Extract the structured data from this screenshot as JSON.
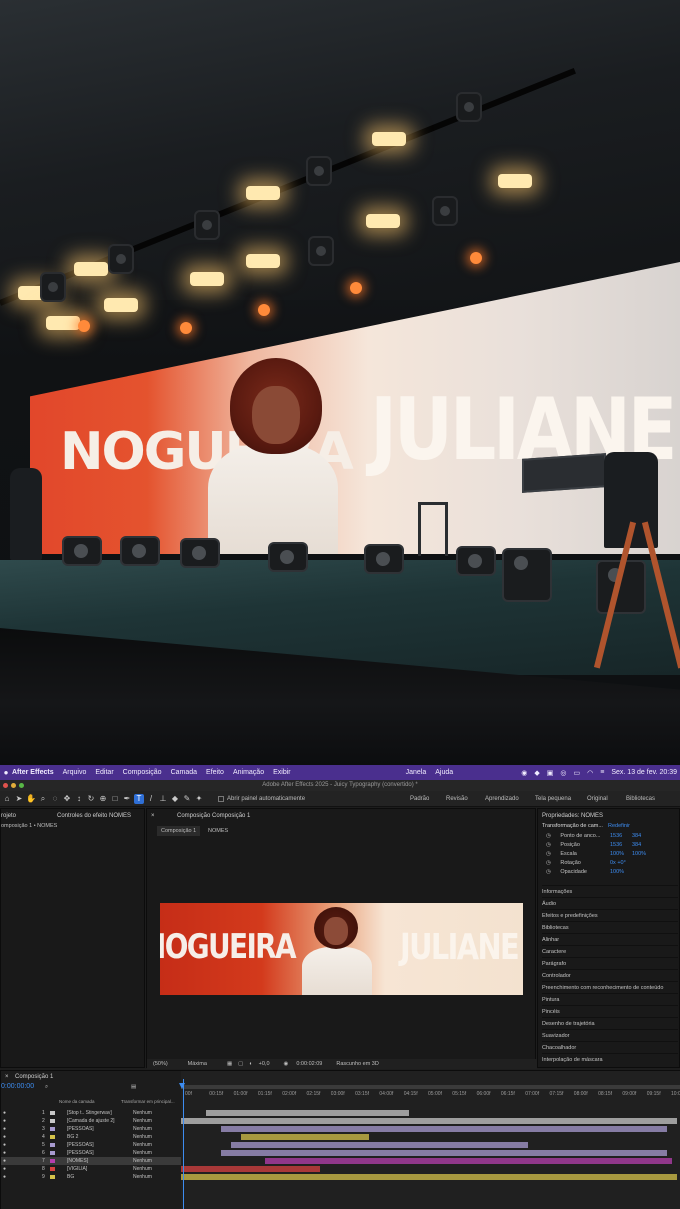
{
  "menubar": {
    "app_name": "After Effects",
    "items": [
      "Arquivo",
      "Editar",
      "Composição",
      "Camada",
      "Efeito",
      "Animação",
      "Exibir",
      "Janela",
      "Ajuda"
    ],
    "date_time": "Sex. 13 de fev. 20:39"
  },
  "window_title": "Adobe After Effects 2025 - Juicy Typography (convertido) *",
  "toolbar": {
    "auto_panel": "Abrir painel automaticamente",
    "workspaces": [
      "Padrão",
      "Revisão",
      "Aprendizado",
      "Tela pequena",
      "Original",
      "Bibliotecas"
    ]
  },
  "project_panel": {
    "tab1": "rojeto",
    "tab2": "Controles do efeito NOMES",
    "breadcrumb": "omposição 1 • NOMES"
  },
  "comp_panel": {
    "tab": "Composição Composição 1",
    "subtab": "Composição 1",
    "subtab2": "NOMES",
    "zoom": "(50%)",
    "quality": "Máxima",
    "exposure": "+0,0",
    "timecode": "0:00:02:09",
    "renderer": "Rascunho em 3D",
    "text_left": "IOGUEIRA",
    "text_right": "JULIANE"
  },
  "properties_panel": {
    "title": "Propriedades: NOMES",
    "transform": "Transformação de cam...",
    "reset": "Redefinir",
    "rows": [
      {
        "label": "Ponto de anco...",
        "v1": "1536",
        "v2": "384"
      },
      {
        "label": "Posição",
        "v1": "1536",
        "v2": "384"
      },
      {
        "label": "Escala",
        "v1": "100%",
        "v2": "100%"
      },
      {
        "label": "Rotação",
        "v1": "0x +0°",
        "v2": ""
      },
      {
        "label": "Opacidade",
        "v1": "100%",
        "v2": ""
      }
    ],
    "sections": [
      "Informações",
      "Áudio",
      "Efeitos e predefinições",
      "Bibliotecas",
      "Alinhar",
      "Caractere",
      "Parágrafo",
      "Controlador",
      "Preenchimento com reconhecimento de conteúdo",
      "Pintura",
      "Pincéis",
      "Desenho de trajetória",
      "Suavizador",
      "Chacoalhador",
      "Interpolação de máscara"
    ]
  },
  "timeline": {
    "tab": "Composição 1",
    "timecode": "0:00:00:00",
    "col_name": "Nome da camada",
    "col_parent": "Transformar em principal...",
    "ruler": [
      "00f",
      "00:15f",
      "01:00f",
      "01:15f",
      "02:00f",
      "02:15f",
      "03:00f",
      "03:15f",
      "04:00f",
      "04:15f",
      "05:00f",
      "05:15f",
      "06:00f",
      "06:15f",
      "07:00f",
      "07:15f",
      "08:00f",
      "08:15f",
      "09:00f",
      "09:15f",
      "10:0"
    ],
    "layers": [
      {
        "num": "1",
        "name": "[Stop t.. Stingerwav]",
        "parent": "Nenhum",
        "color": "#c8c8c8"
      },
      {
        "num": "2",
        "name": "[Camada de ajuste 2]",
        "parent": "Nenhum",
        "color": "#c8c8c8"
      },
      {
        "num": "3",
        "name": "[PESSOAS]",
        "parent": "Nenhum",
        "color": "#a89bd0"
      },
      {
        "num": "4",
        "name": "BG 2",
        "parent": "Nenhum",
        "color": "#d4c24a"
      },
      {
        "num": "5",
        "name": "[PESSOAS]",
        "parent": "Nenhum",
        "color": "#a89bd0"
      },
      {
        "num": "6",
        "name": "[PESSOAS]",
        "parent": "Nenhum",
        "color": "#a89bd0"
      },
      {
        "num": "7",
        "name": "[NOMES]",
        "parent": "Nenhum",
        "color": "#b53fae"
      },
      {
        "num": "8",
        "name": "[VIGILIA]",
        "parent": "Nenhum",
        "color": "#d64040"
      },
      {
        "num": "9",
        "name": "BG",
        "parent": "Nenhum",
        "color": "#d4c24a"
      }
    ]
  },
  "photo": {
    "led_left": "NOGUEIRA",
    "led_right": "JULIANE"
  }
}
